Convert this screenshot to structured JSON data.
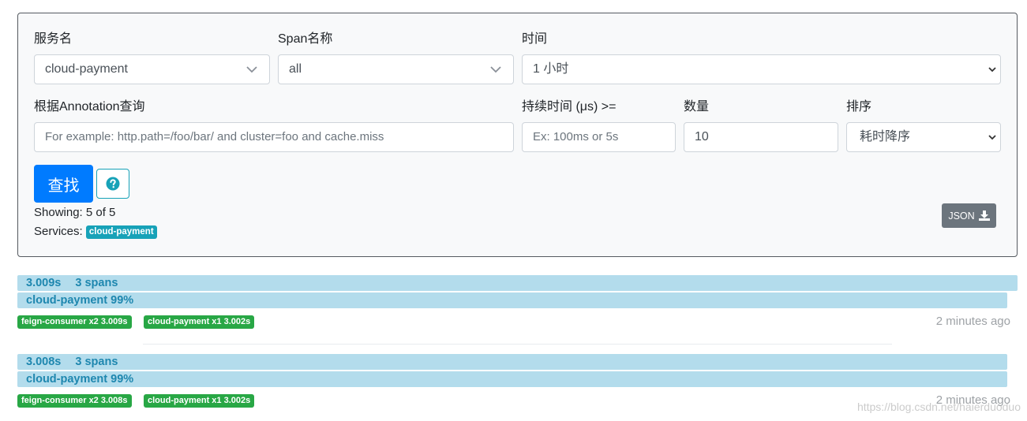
{
  "search": {
    "service_label": "服务名",
    "service_value": "cloud-payment",
    "span_label": "Span名称",
    "span_value": "all",
    "time_label": "时间",
    "time_value": "1 小时",
    "annotation_label": "根据Annotation查询",
    "annotation_placeholder": "For example: http.path=/foo/bar/ and cluster=foo and cache.miss",
    "duration_label": "持续时间 (μs) >=",
    "duration_placeholder": "Ex: 100ms or 5s",
    "limit_label": "数量",
    "limit_value": "10",
    "sort_label": "排序",
    "sort_value": "耗时降序",
    "search_button": "查找",
    "showing_text": "Showing: 5 of 5",
    "services_label": "Services:",
    "services_badge": "cloud-payment",
    "json_button": "JSON"
  },
  "traces": [
    {
      "duration": "3.009s",
      "spans": "3 spans",
      "service_summary": "cloud-payment 99%",
      "tags": [
        "feign-consumer x2 3.009s",
        "cloud-payment x1 3.002s"
      ],
      "time_ago": "2 minutes ago"
    },
    {
      "duration": "3.008s",
      "spans": "3 spans",
      "service_summary": "cloud-payment 99%",
      "tags": [
        "feign-consumer x2 3.008s",
        "cloud-payment x1 3.002s"
      ],
      "time_ago": "2 minutes ago"
    }
  ],
  "watermark": "https://blog.csdn.net/haierduoduo",
  "colors": {
    "primary": "#007bff",
    "info": "#17a2b8",
    "success": "#28a745",
    "secondary": "#6c757d",
    "trace_bar": "#b3dcec"
  }
}
